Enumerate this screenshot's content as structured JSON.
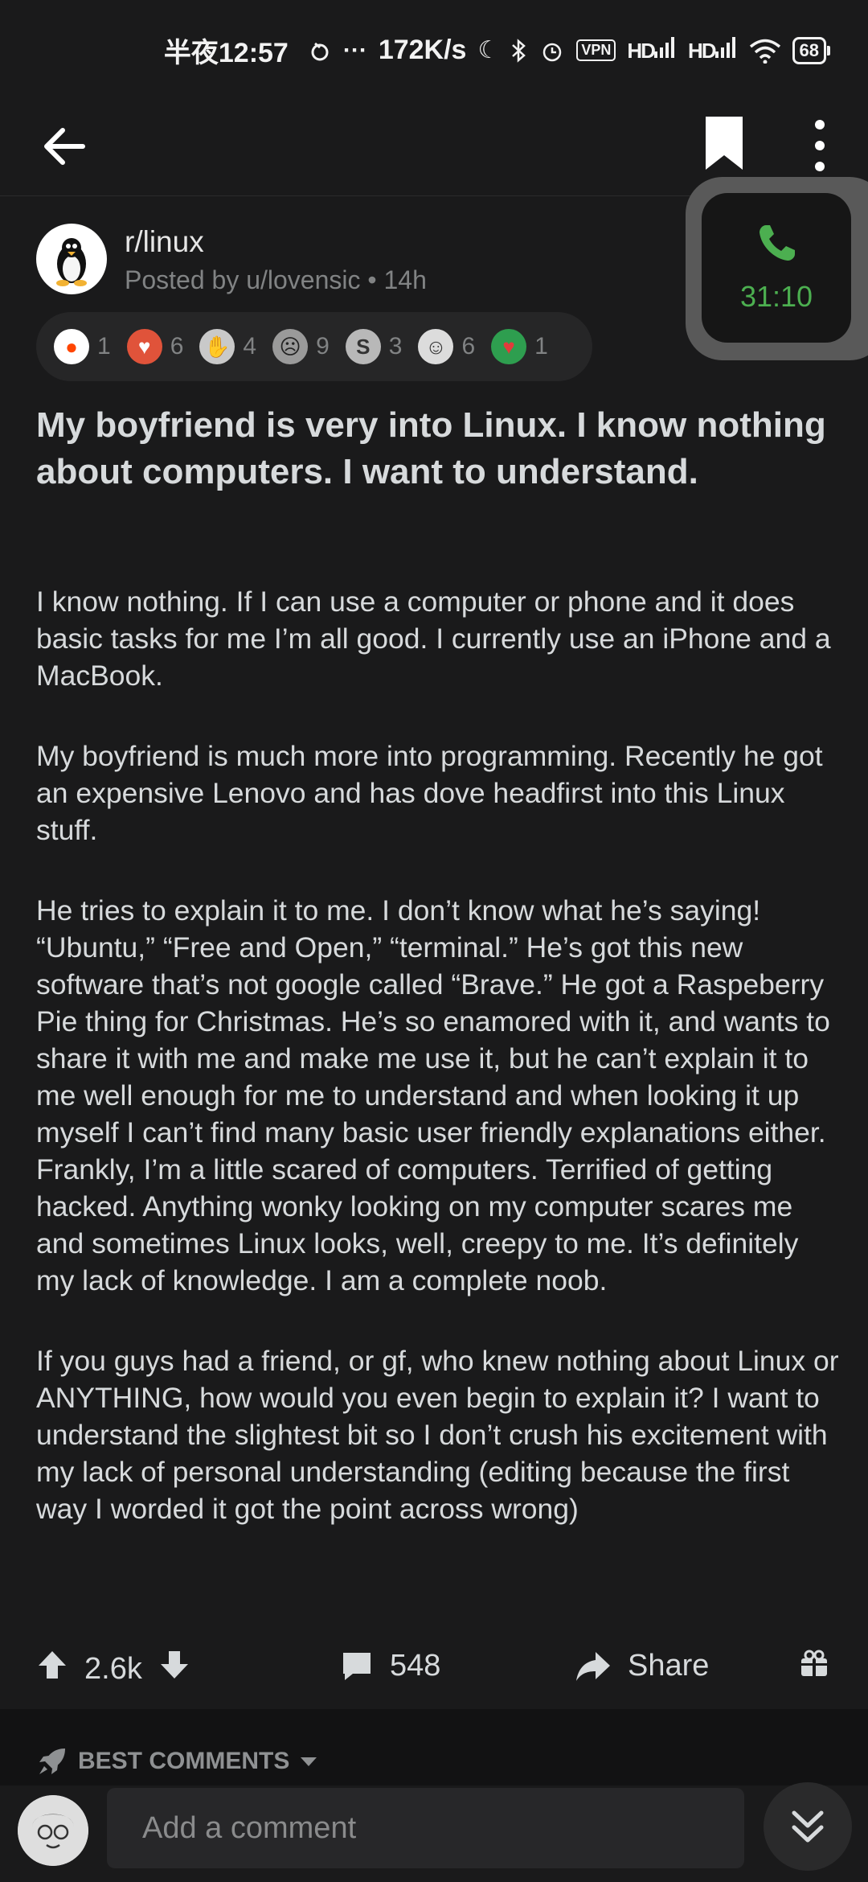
{
  "status_bar": {
    "time": "半夜12:57",
    "network_speed": "172K/s",
    "vpn": "VPN",
    "hd1": "HD",
    "hd2": "HD",
    "battery": "68",
    "dots": "···"
  },
  "post": {
    "subreddit": "r/linux",
    "posted_by": "Posted by u/lovensic • 14h",
    "awards": [
      {
        "icon": "snoo-award-icon",
        "count": "1",
        "color": "#ff4500"
      },
      {
        "icon": "hug-award-icon",
        "count": "6",
        "color": "#e0533a"
      },
      {
        "icon": "handshake-award-icon",
        "count": "4",
        "color": "#c9c9c9"
      },
      {
        "icon": "faceplam-award-icon",
        "count": "9",
        "color": "#9a9a9a"
      },
      {
        "icon": "silver-award-icon",
        "count": "3",
        "color": "#b8b8b8"
      },
      {
        "icon": "wholesome-award-icon",
        "count": "6",
        "color": "#dcdcdc"
      },
      {
        "icon": "heart-award-icon",
        "count": "1",
        "color": "#e23b3b"
      }
    ],
    "title": "My boyfriend is very into Linux. I know nothing about computers. I want to understand.",
    "paragraphs": [
      "I know nothing. If I can use a computer or phone and it does basic tasks for me I’m all good. I currently use an iPhone and a MacBook.",
      "My boyfriend is much more into programming. Recently he got an expensive Lenovo and has dove headfirst into this Linux stuff.",
      "He tries to explain it to me. I don’t know what he’s saying! “Ubuntu,” “Free and Open,” “terminal.” He’s got this new software that’s not google called “Brave.” He got a Raspeberry Pie thing for Christmas. He’s so enamored with it, and wants to share it with me and make me use it, but he can’t explain it to me well enough for me to understand and when looking it up myself I can’t find many basic user friendly explanations either. Frankly, I’m a little scared of computers. Terrified of getting hacked. Anything wonky looking on my computer scares me and sometimes Linux looks, well, creepy to me. It’s definitely my lack of knowledge. I am a complete noob.",
      "If you guys had a friend, or gf, who knew nothing about Linux or ANYTHING, how would you even begin to explain it? I want to understand the slightest bit so I don’t crush his excitement with my lack of personal understanding (editing because the first way I worded it got the point across wrong)"
    ],
    "upvotes": "2.6k",
    "comments": "548",
    "share_label": "Share"
  },
  "call_overlay": {
    "duration": "31:10",
    "accent": "#4caf50"
  },
  "comments_section": {
    "sort_label": "BEST COMMENTS"
  },
  "comment_bar": {
    "placeholder": "Add a comment"
  }
}
